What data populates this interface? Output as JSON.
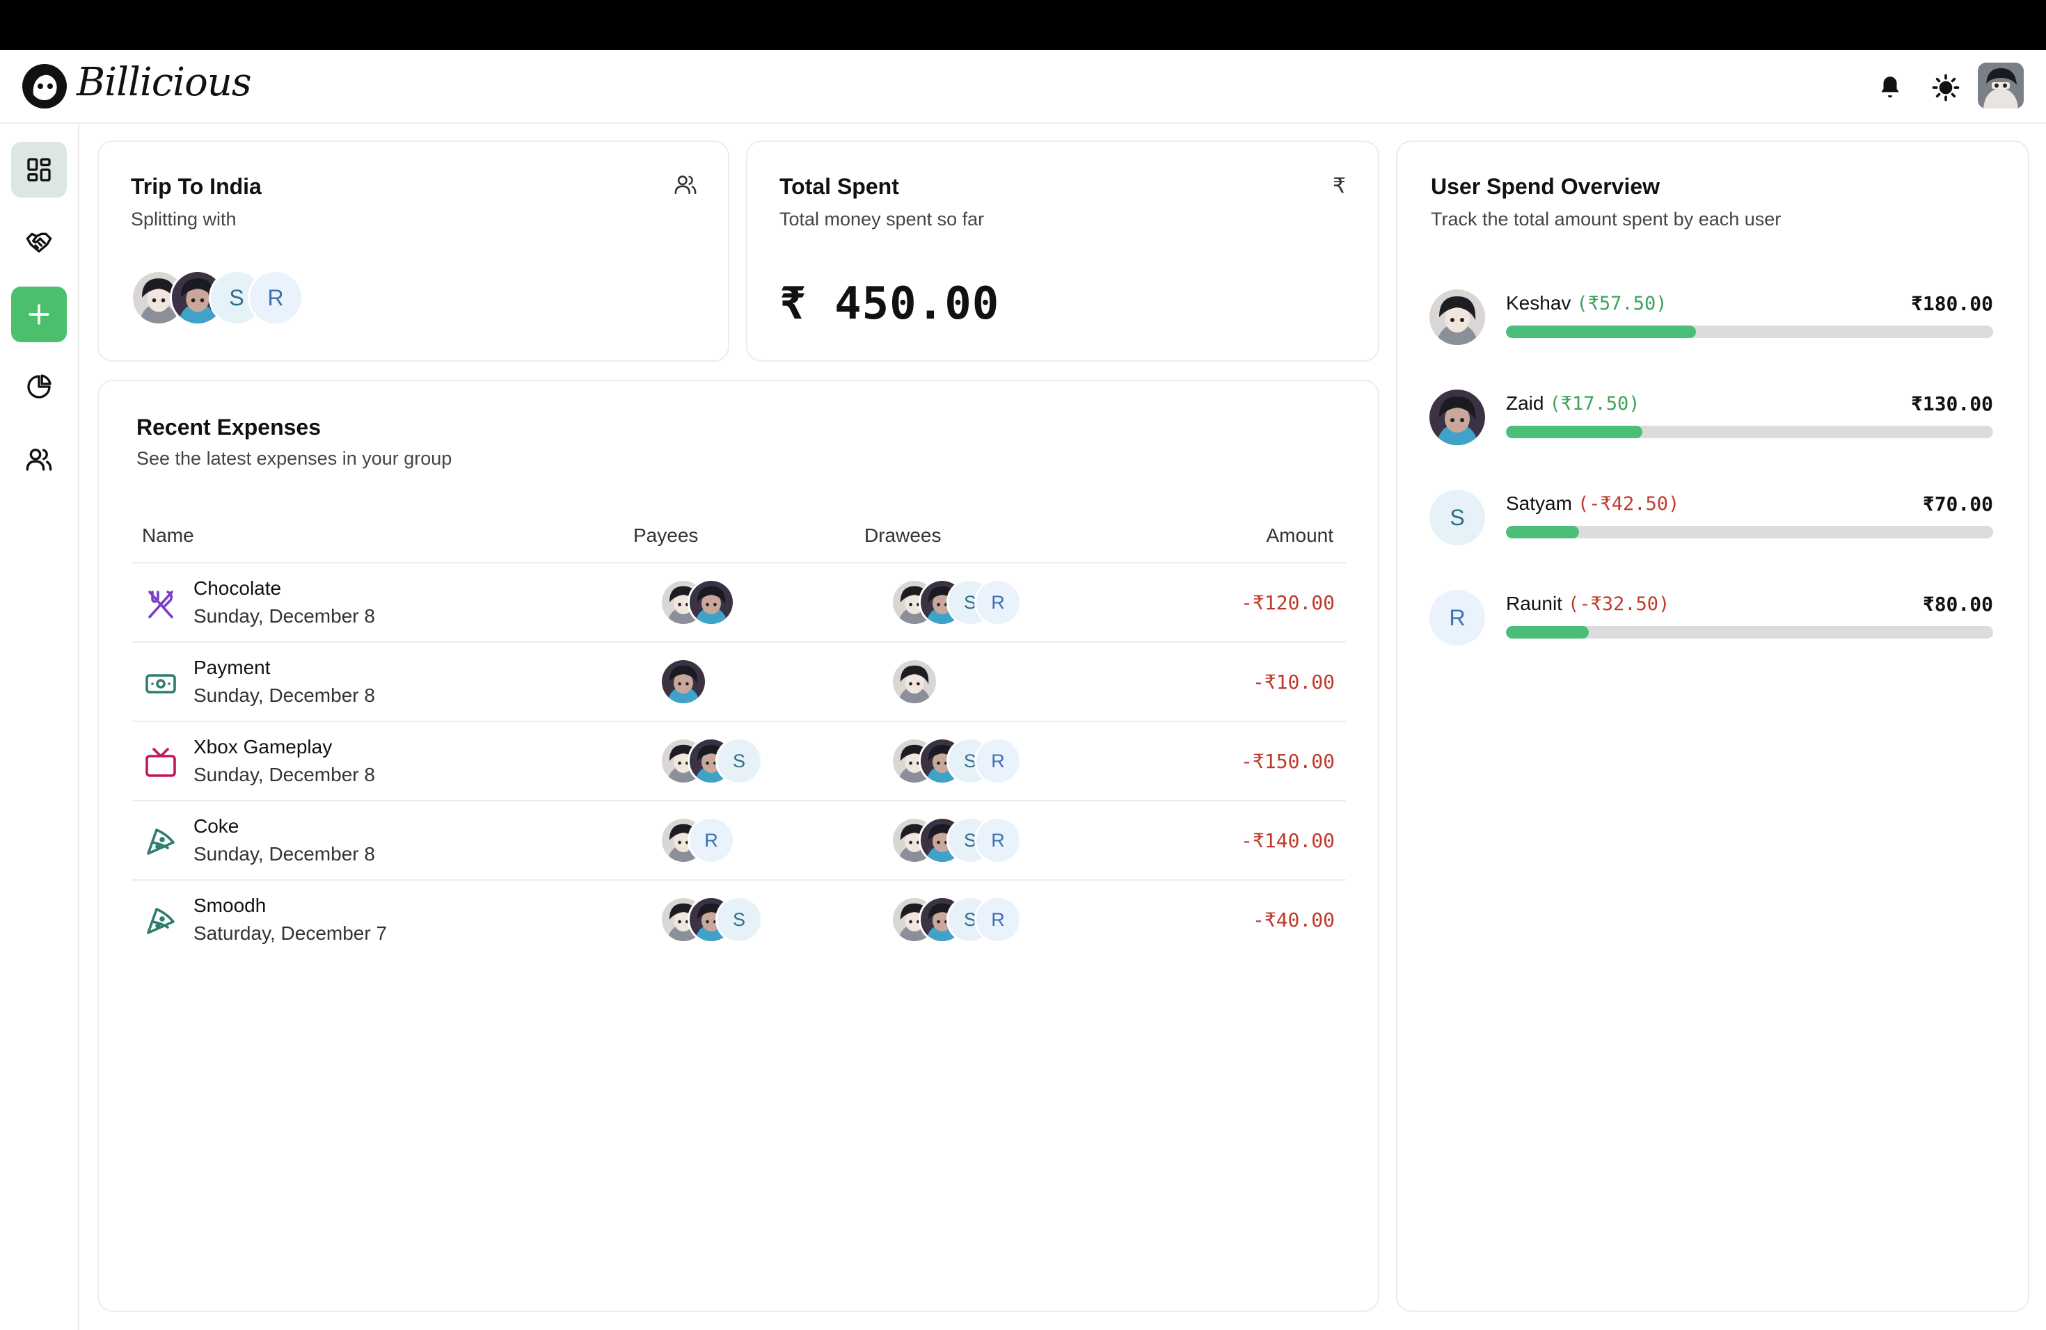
{
  "app": {
    "name": "Billicious"
  },
  "colors": {
    "accent": "#4bbf6b",
    "negative": "#c0392b",
    "positive": "#3aa55a",
    "bar_track": "#dcdcdc"
  },
  "header": {
    "icons": [
      "bell-icon",
      "sun-icon"
    ]
  },
  "sidebar": {
    "items": [
      "dashboard-icon",
      "handshake-icon",
      "plus-icon",
      "pie-chart-icon",
      "users-icon"
    ]
  },
  "group_card": {
    "title": "Trip To India",
    "subtitle": "Splitting with",
    "members": [
      {
        "type": "photo",
        "style": "light"
      },
      {
        "type": "photo",
        "style": "dark"
      },
      {
        "type": "letter",
        "letter": "S"
      },
      {
        "type": "letter",
        "letter": "R"
      }
    ]
  },
  "total_card": {
    "title": "Total Spent",
    "subtitle": "Total money spent so far",
    "currency_icon": "₹",
    "amount": "₹ 450.00"
  },
  "expenses_card": {
    "title": "Recent Expenses",
    "subtitle": "See the latest expenses in your group",
    "columns": {
      "name": "Name",
      "payees": "Payees",
      "drawees": "Drawees",
      "amount": "Amount"
    },
    "rows": [
      {
        "icon": "utensils-icon",
        "icon_color": "#7a3fc4",
        "name": "Chocolate",
        "date": "Sunday, December 8",
        "amount": "-₹120.00",
        "payees": [
          {
            "type": "photo",
            "style": "light"
          },
          {
            "type": "photo",
            "style": "dark"
          }
        ],
        "drawees": [
          {
            "type": "photo",
            "style": "light"
          },
          {
            "type": "photo",
            "style": "dark"
          },
          {
            "type": "letter",
            "letter": "S"
          },
          {
            "type": "letter",
            "letter": "R"
          }
        ]
      },
      {
        "icon": "banknote-icon",
        "icon_color": "#2e7d6e",
        "name": "Payment",
        "date": "Sunday, December 8",
        "amount": "-₹10.00",
        "payees": [
          {
            "type": "photo",
            "style": "dark"
          }
        ],
        "drawees": [
          {
            "type": "photo",
            "style": "light"
          }
        ]
      },
      {
        "icon": "tv-icon",
        "icon_color": "#c2185b",
        "name": "Xbox Gameplay",
        "date": "Sunday, December 8",
        "amount": "-₹150.00",
        "payees": [
          {
            "type": "photo",
            "style": "light"
          },
          {
            "type": "photo",
            "style": "dark"
          },
          {
            "type": "letter",
            "letter": "S"
          }
        ],
        "drawees": [
          {
            "type": "photo",
            "style": "light"
          },
          {
            "type": "photo",
            "style": "dark"
          },
          {
            "type": "letter",
            "letter": "S"
          },
          {
            "type": "letter",
            "letter": "R"
          }
        ]
      },
      {
        "icon": "pizza-icon",
        "icon_color": "#2e7d6e",
        "name": "Coke",
        "date": "Sunday, December 8",
        "amount": "-₹140.00",
        "payees": [
          {
            "type": "photo",
            "style": "light"
          },
          {
            "type": "letter",
            "letter": "R"
          }
        ],
        "drawees": [
          {
            "type": "photo",
            "style": "light"
          },
          {
            "type": "photo",
            "style": "dark"
          },
          {
            "type": "letter",
            "letter": "S"
          },
          {
            "type": "letter",
            "letter": "R"
          }
        ]
      },
      {
        "icon": "pizza-icon",
        "icon_color": "#2e7d6e",
        "name": "Smoodh",
        "date": "Saturday, December 7",
        "amount": "-₹40.00",
        "payees": [
          {
            "type": "photo",
            "style": "light"
          },
          {
            "type": "photo",
            "style": "dark"
          },
          {
            "type": "letter",
            "letter": "S"
          }
        ],
        "drawees": [
          {
            "type": "photo",
            "style": "light"
          },
          {
            "type": "photo",
            "style": "dark"
          },
          {
            "type": "letter",
            "letter": "S"
          },
          {
            "type": "letter",
            "letter": "R"
          }
        ]
      }
    ]
  },
  "overview_card": {
    "title": "User Spend Overview",
    "subtitle": "Track the total amount spent by each user",
    "users": [
      {
        "name": "Keshav",
        "balance": "(₹57.50)",
        "balance_sign": "pos",
        "amount": "₹180.00",
        "fill": 0.39,
        "avatar": {
          "type": "photo",
          "style": "light"
        }
      },
      {
        "name": "Zaid",
        "balance": "(₹17.50)",
        "balance_sign": "pos",
        "amount": "₹130.00",
        "fill": 0.28,
        "avatar": {
          "type": "photo",
          "style": "dark"
        }
      },
      {
        "name": "Satyam",
        "balance": "(-₹42.50)",
        "balance_sign": "neg",
        "amount": "₹70.00",
        "fill": 0.15,
        "avatar": {
          "type": "letter",
          "letter": "S"
        }
      },
      {
        "name": "Raunit",
        "balance": "(-₹32.50)",
        "balance_sign": "neg",
        "amount": "₹80.00",
        "fill": 0.17,
        "avatar": {
          "type": "letter",
          "letter": "R"
        }
      }
    ]
  }
}
